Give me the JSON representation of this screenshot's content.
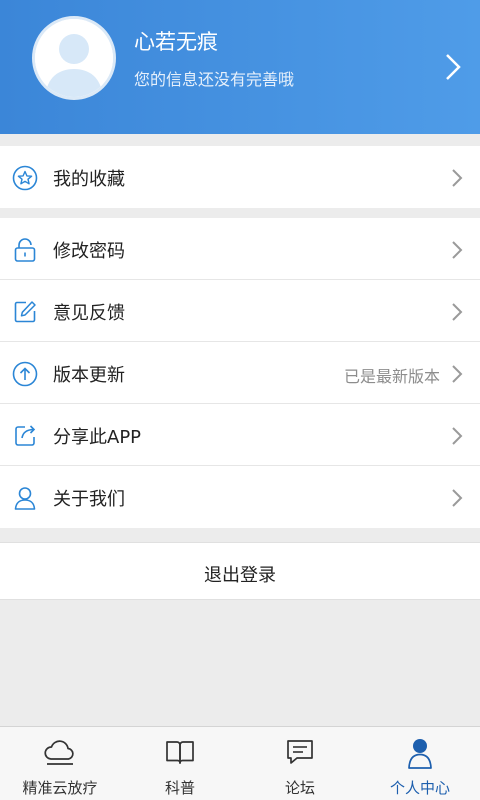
{
  "profile": {
    "name": "心若无痕",
    "subtitle": "您的信息还没有完善哦"
  },
  "menu": {
    "favorites": {
      "label": "我的收藏",
      "icon": "star-icon"
    },
    "items": [
      {
        "label": "修改密码",
        "icon": "lock-icon",
        "value": ""
      },
      {
        "label": "意见反馈",
        "icon": "edit-icon",
        "value": ""
      },
      {
        "label": "版本更新",
        "icon": "upload-icon",
        "value": "已是最新版本"
      },
      {
        "label": "分享此APP",
        "icon": "share-icon",
        "value": ""
      },
      {
        "label": "关于我们",
        "icon": "user-icon",
        "value": ""
      }
    ]
  },
  "logout": {
    "label": "退出登录"
  },
  "tabbar": {
    "tabs": [
      {
        "label": "精准云放疗",
        "icon": "cloud-icon"
      },
      {
        "label": "科普",
        "icon": "book-icon"
      },
      {
        "label": "论坛",
        "icon": "chat-icon"
      },
      {
        "label": "个人中心",
        "icon": "person-icon",
        "active": true
      }
    ]
  },
  "colors": {
    "header": "#3b86d8",
    "accent": "#2b86d6",
    "active_tab": "#1d5fae"
  }
}
